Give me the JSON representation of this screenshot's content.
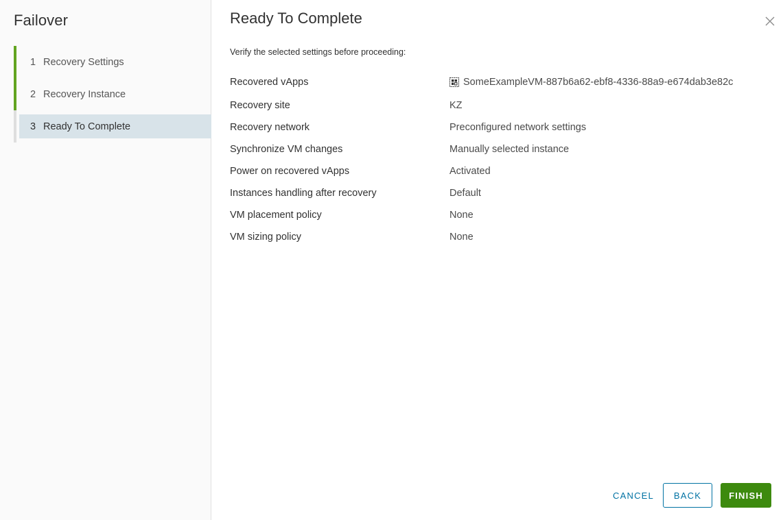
{
  "wizard": {
    "title": "Failover",
    "steps": [
      {
        "number": "1",
        "label": "Recovery Settings",
        "state": "complete"
      },
      {
        "number": "2",
        "label": "Recovery Instance",
        "state": "complete"
      },
      {
        "number": "3",
        "label": "Ready To Complete",
        "state": "active"
      }
    ]
  },
  "page": {
    "title": "Ready To Complete",
    "subtitle": "Verify the selected settings before proceeding:"
  },
  "summary": [
    {
      "key": "Recovered vApps",
      "value": "SomeExampleVM-887b6a62-ebf8-4336-88a9-e674dab3e82c",
      "icon": "vapp-icon"
    },
    {
      "key": "Recovery site",
      "value": "KZ"
    },
    {
      "key": "Recovery network",
      "value": "Preconfigured network settings"
    },
    {
      "key": "Synchronize VM changes",
      "value": "Manually selected instance"
    },
    {
      "key": "Power on recovered vApps",
      "value": "Activated"
    },
    {
      "key": "Instances handling after recovery",
      "value": "Default"
    },
    {
      "key": "VM placement policy",
      "value": "None"
    },
    {
      "key": "VM sizing policy",
      "value": "None"
    }
  ],
  "footer": {
    "cancel_label": "CANCEL",
    "back_label": "BACK",
    "finish_label": "FINISH"
  },
  "colors": {
    "complete_step": "#62a420",
    "active_step_bg": "#d8e3e9",
    "primary_button": "#3d8a0e",
    "link": "#0072a3"
  }
}
